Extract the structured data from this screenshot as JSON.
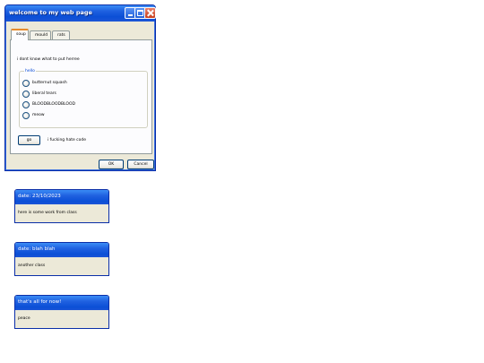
{
  "window": {
    "title": "welcome to my web page",
    "tabs": [
      {
        "label": "soup",
        "active": true
      },
      {
        "label": "mould",
        "active": false
      },
      {
        "label": "rats",
        "active": false
      }
    ],
    "intro_text": "i dont know what to put herree",
    "group": {
      "legend": "hello",
      "options": [
        {
          "label": "butternut squash",
          "selected": false
        },
        {
          "label": "liberal tears",
          "selected": false
        },
        {
          "label": "BLOODBLOODBLOOD",
          "selected": false
        },
        {
          "label": "meow",
          "selected": false
        }
      ]
    },
    "go_button": "go",
    "side_text": "i fucking hate code",
    "ok_button": "OK",
    "cancel_button": "Cancel"
  },
  "notes": [
    {
      "title": "date: 23/10/2023",
      "body": "here is some work from class"
    },
    {
      "title": "date: blah blah",
      "body": "another class"
    },
    {
      "title": "that's all for now!",
      "body": "peace"
    }
  ],
  "colors": {
    "title_blue": "#0b4fd6",
    "window_face": "#ece9d8",
    "tab_highlight": "#e68b2c",
    "legend_blue": "#0046d5"
  }
}
